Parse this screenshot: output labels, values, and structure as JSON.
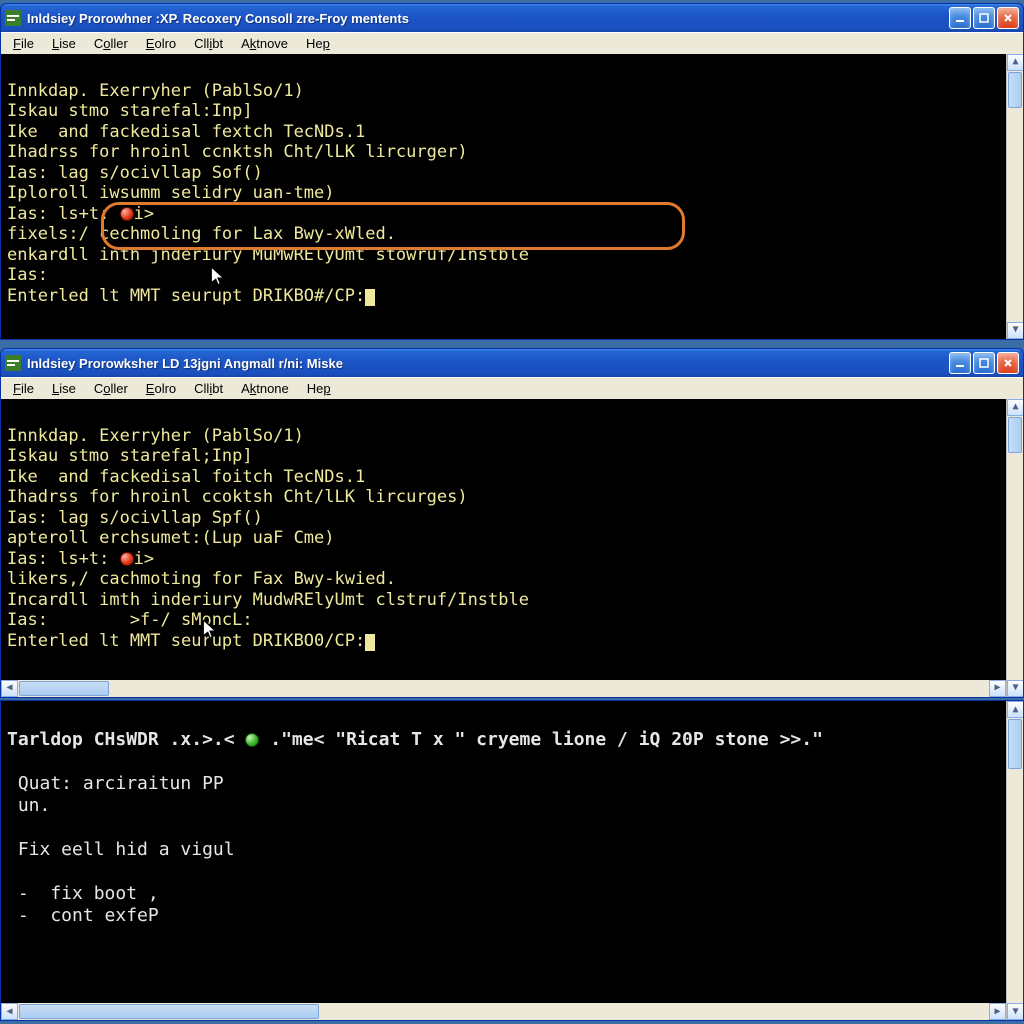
{
  "window1": {
    "title": "Inldsiey Prorowhner :XP. Recoxery Consoll zre-Froy mentents",
    "menu": [
      "File",
      "Lise",
      "Coller",
      "Eolro",
      "Cllibt",
      "Aktnove",
      "Hep"
    ],
    "console": {
      "l1": "Innkdap. Exerryher (PablSo/1)",
      "l2": "Iskau stmo starefal:Inp]",
      "l3": "Ike  and fackedisal fextch TecNDs.1",
      "l4": "Ihadrss for hroinl ccnktsh Cht/lLK lircurger)",
      "l5": "Ias: lag s/ocivllap Sof()",
      "l6": "Iploroll iwsumm selidry uan-tme)",
      "l7a": "Ias: ls+t: ",
      "l7b": "i>",
      "l8": "fixels:/ cechmoling for Lax Bwy-xWled.",
      "l9": "enkardll inth jnderiury MuMwRElyUmt stowruf/Instble",
      "l10": "Ias:",
      "l11": "Enterled lt MMT seurupt DRIKBO#/CP:"
    }
  },
  "window2": {
    "title": "Inldsiey Prorowksher LD 13jgni Angmall r/ni: Miske",
    "menu": [
      "File",
      "Lise",
      "Coller",
      "Eolro",
      "Cllibt",
      "Aktnone",
      "Hep"
    ],
    "console": {
      "l1": "Innkdap. Exerryher (PablSo/1)",
      "l2": "Iskau stmo starefal;Inp]",
      "l3": "Ike  and fackedisal foitch TecNDs.1",
      "l4": "Ihadrss for hroinl ccoktsh Cht/lLK lircurges)",
      "l5": "Ias: lag s/ocivllap Spf()",
      "l6": "apteroll erchsumet:(Lup uaF Cme)",
      "l7a": "Ias: ls+t: ",
      "l7b": "i>",
      "l8": "likers,/ cachmoting for Fax Bwy-kwied.",
      "l9": "Incardll imth inderiury MudwRElyUmt clstruf/Instble",
      "l10": "Ias:        >f-/ sMoncL:",
      "l11": "Enterled lt MMT seurupt DRIKBO0/CP:"
    }
  },
  "pane3": {
    "line1a": "Tarldop CHsWDR .x.>.< ",
    "line1b": " .\"me< \"Ricat T x \" cryeme lione / iQ 20P stone >>.\"",
    "p2": " Quat: arciraitun PP",
    "p3": " un.",
    "p4": " Fix eell hid a vigul",
    "p5": " -  fix boot ,",
    "p6": " -  cont exfeP"
  }
}
